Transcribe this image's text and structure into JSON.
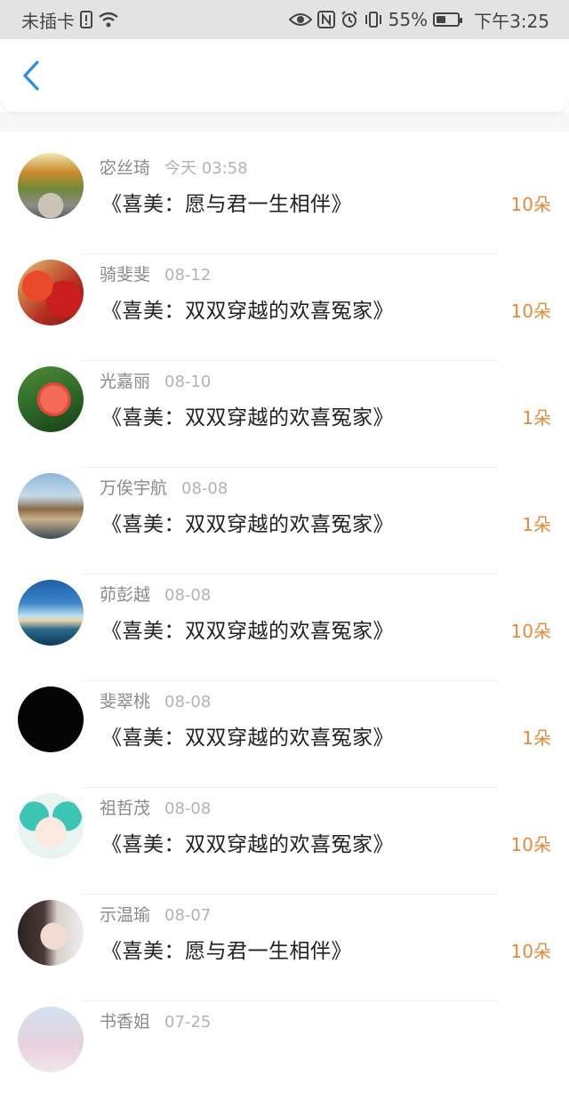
{
  "status_bar": {
    "carrier": "未插卡",
    "battery": "55%",
    "time": "下午3:25",
    "icons": [
      "sim-alert-icon",
      "wifi-icon",
      "eye-icon",
      "nfc-icon",
      "alarm-icon",
      "vibrate-icon",
      "battery-icon"
    ],
    "battery_level": 0.55
  },
  "nav": {
    "back_icon": "chevron-left-icon",
    "accent": "#2a8ee8"
  },
  "colors": {
    "count": "#e98a3a",
    "name": "#8a8a8a",
    "time": "#b3b3b3"
  },
  "items": [
    {
      "name": "宓丝琦",
      "time": "今天 03:58",
      "title": "《喜美：愿与君一生相伴》",
      "count": "10朵",
      "avatar": "road-autumn"
    },
    {
      "name": "骑斐斐",
      "time": "08-12",
      "title": "《喜美：双双穿越的欢喜冤家》",
      "count": "10朵",
      "avatar": "red-leaves"
    },
    {
      "name": "光嘉丽",
      "time": "08-10",
      "title": "《喜美：双双穿越的欢喜冤家》",
      "count": "1朵",
      "avatar": "red-flower"
    },
    {
      "name": "万俟宇航",
      "time": "08-08",
      "title": "《喜美：双双穿越的欢喜冤家》",
      "count": "1朵",
      "avatar": "rocky-coast"
    },
    {
      "name": "茆彭越",
      "time": "08-08",
      "title": "《喜美：双双穿越的欢喜冤家》",
      "count": "10朵",
      "avatar": "seascape"
    },
    {
      "name": "斐翠桃",
      "time": "08-08",
      "title": "《喜美：双双穿越的欢喜冤家》",
      "count": "1朵",
      "avatar": "black-text"
    },
    {
      "name": "祖哲茂",
      "time": "08-08",
      "title": "《喜美：双双穿越的欢喜冤家》",
      "count": "10朵",
      "avatar": "anime"
    },
    {
      "name": "示温瑜",
      "time": "08-07",
      "title": "《喜美：愿与君一生相伴》",
      "count": "10朵",
      "avatar": "girl-portrait"
    },
    {
      "name": "书香姐",
      "time": "07-25",
      "title": "",
      "count": "",
      "avatar": "pastel"
    }
  ]
}
